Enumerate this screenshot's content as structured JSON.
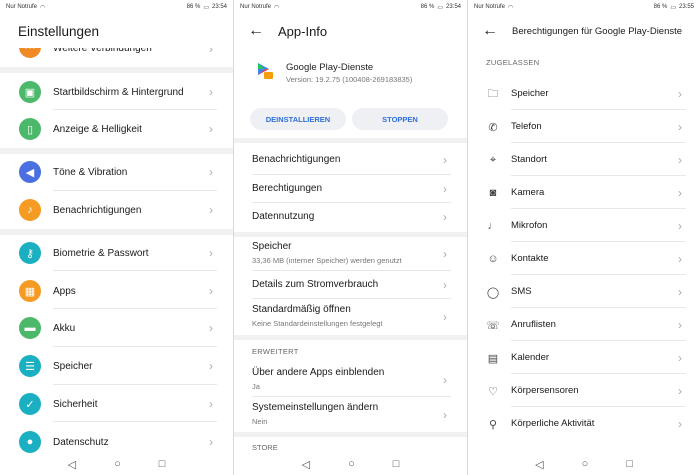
{
  "status_bar": {
    "carrier": "Nur Notrufe",
    "battery": "86 %",
    "time_a": "23:54",
    "time_b": "23:54",
    "time_c": "23:55"
  },
  "panel1": {
    "title": "Einstellungen",
    "items": [
      {
        "label": "Weitere Verbindungen",
        "color": "#f08a24"
      },
      {
        "label": "Startbildschirm & Hintergrund",
        "color": "#4cb96a"
      },
      {
        "label": "Anzeige & Helligkeit",
        "color": "#4cb96a"
      },
      {
        "label": "Töne & Vibration",
        "color": "#4a6fe0"
      },
      {
        "label": "Benachrichtigungen",
        "color": "#f59a23"
      },
      {
        "label": "Biometrie & Passwort",
        "color": "#1ab0c2"
      },
      {
        "label": "Apps",
        "color": "#f59a23"
      },
      {
        "label": "Akku",
        "color": "#4cb96a"
      },
      {
        "label": "Speicher",
        "color": "#1ab0c2"
      },
      {
        "label": "Sicherheit",
        "color": "#1ab0c2"
      },
      {
        "label": "Datenschutz",
        "color": "#1ab0c2"
      }
    ]
  },
  "panel2": {
    "title": "App-Info",
    "app_name": "Google Play-Dienste",
    "app_version": "Version: 19.2.75 (100408-269183835)",
    "uninstall": "DEINSTALLIEREN",
    "stop": "STOPPEN",
    "items": [
      {
        "label": "Benachrichtigungen"
      },
      {
        "label": "Berechtigungen"
      },
      {
        "label": "Datennutzung"
      }
    ],
    "storage_label": "Speicher",
    "storage_sub": "33,36 MB (interner Speicher) werden genutzt",
    "power_label": "Details zum Stromverbrauch",
    "default_label": "Standardmäßig öffnen",
    "default_sub": "Keine Standardeinstellungen festgelegt",
    "advanced": "ERWEITERT",
    "overlay_label": "Über andere Apps einblenden",
    "overlay_sub": "Ja",
    "system_label": "Systemeinstellungen ändern",
    "system_sub": "Nein",
    "store": "STORE"
  },
  "panel3": {
    "title": "Berechtigungen für Google Play-Dienste",
    "section": "ZUGELASSEN",
    "items": [
      {
        "label": "Speicher",
        "icon": "folder-icon"
      },
      {
        "label": "Telefon",
        "icon": "phone-icon"
      },
      {
        "label": "Standort",
        "icon": "location-icon"
      },
      {
        "label": "Kamera",
        "icon": "camera-icon"
      },
      {
        "label": "Mikrofon",
        "icon": "microphone-icon"
      },
      {
        "label": "Kontakte",
        "icon": "contacts-icon"
      },
      {
        "label": "SMS",
        "icon": "sms-icon"
      },
      {
        "label": "Anruflisten",
        "icon": "call-log-icon"
      },
      {
        "label": "Kalender",
        "icon": "calendar-icon"
      },
      {
        "label": "Körpersensoren",
        "icon": "heart-icon"
      },
      {
        "label": "Körperliche Aktivität",
        "icon": "running-icon"
      }
    ]
  }
}
